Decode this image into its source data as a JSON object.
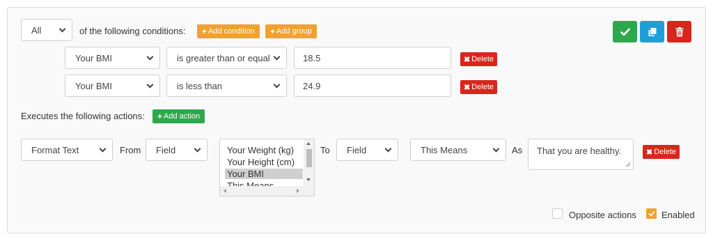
{
  "conditions_header": {
    "match_select": "All",
    "label": "of the following conditions:",
    "add_condition": "Add condition",
    "add_group": "Add group"
  },
  "toolbar": {
    "save_icon": "check-icon",
    "copy_icon": "copy-icon",
    "delete_icon": "trash-icon"
  },
  "conditions": [
    {
      "field": "Your BMI",
      "operator": "is greater than or equal",
      "value": "18.5",
      "delete": "Delete"
    },
    {
      "field": "Your BMI",
      "operator": "is less than",
      "value": "24.9",
      "delete": "Delete"
    }
  ],
  "actions_header": {
    "label": "Executes the following actions:",
    "add_action": "Add action"
  },
  "action": {
    "type": "Format Text",
    "from_label": "From",
    "from_select": "Field",
    "field_list": [
      "Your Weight (kg)",
      "Your Height (cm)",
      "Your BMI",
      "This Means"
    ],
    "field_list_selected": "Your BMI",
    "to_label": "To",
    "to_select": "Field",
    "target_field": "This Means",
    "as_label": "As",
    "text_value": "That you are healthy.",
    "delete": "Delete"
  },
  "footer": {
    "opposite_actions": "Opposite actions",
    "opposite_checked": false,
    "enabled": "Enabled",
    "enabled_checked": true
  },
  "colors": {
    "green": "#2ea84d",
    "blue": "#1e9fd9",
    "red": "#d9261c",
    "orange": "#f0a130"
  }
}
